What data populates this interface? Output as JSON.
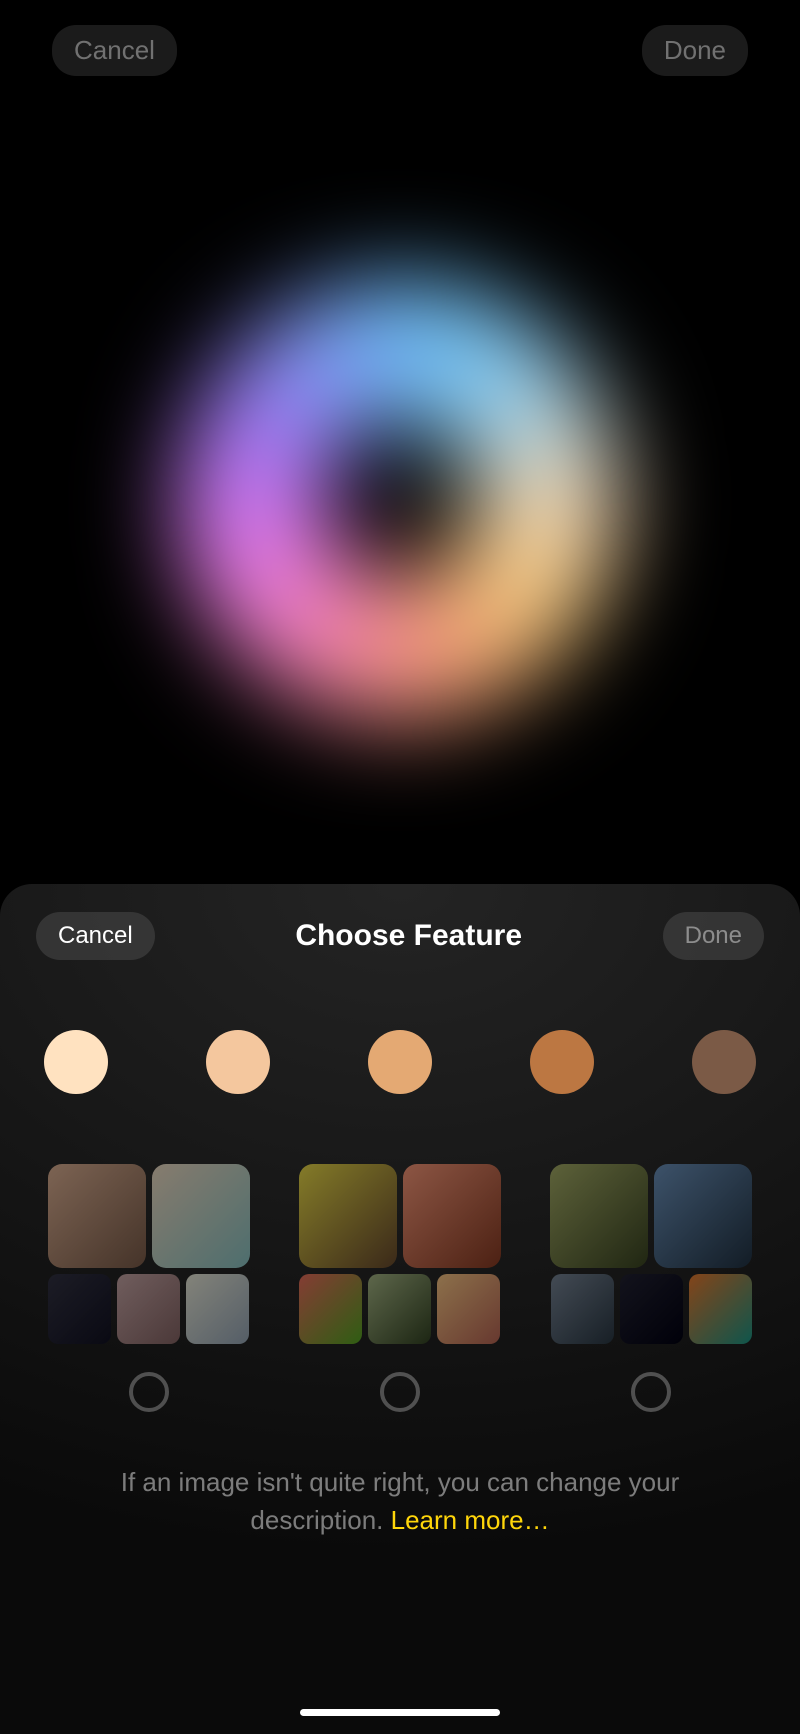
{
  "topbar": {
    "cancel": "Cancel",
    "done": "Done"
  },
  "sheet": {
    "cancel": "Cancel",
    "title": "Choose Feature",
    "done": "Done"
  },
  "swatches": [
    "#ffe2c0",
    "#f4c79e",
    "#e4a973",
    "#bc7742",
    "#7b5a46"
  ],
  "hint": {
    "text": "If an image isn't quite right, you can change your description. ",
    "link": "Learn more…"
  }
}
